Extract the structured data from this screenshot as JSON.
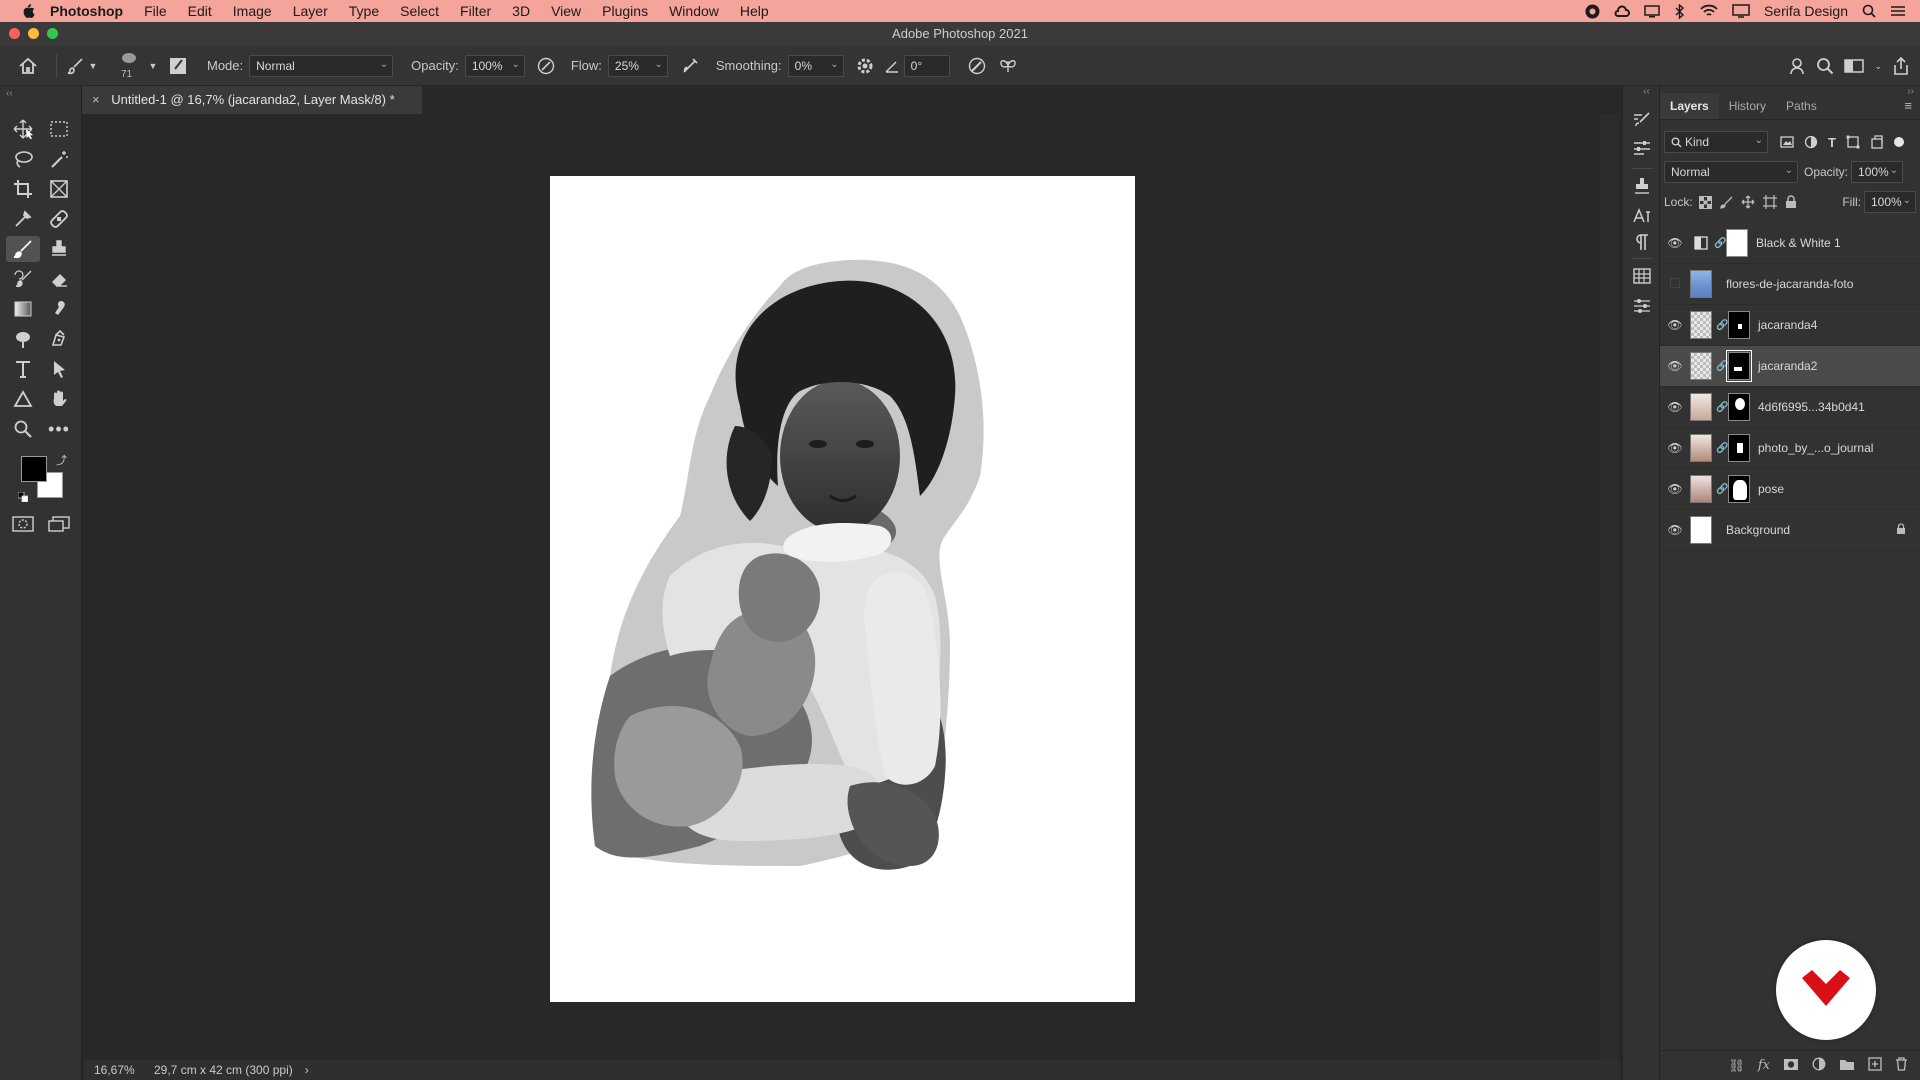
{
  "menubar": {
    "app": "Photoshop",
    "items": [
      "File",
      "Edit",
      "Image",
      "Layer",
      "Type",
      "Select",
      "Filter",
      "3D",
      "View",
      "Plugins",
      "Window",
      "Help"
    ],
    "account": "Serifa Design"
  },
  "window": {
    "title": "Adobe Photoshop 2021"
  },
  "options": {
    "brush_size": "71",
    "mode_label": "Mode:",
    "mode_value": "Normal",
    "opacity_label": "Opacity:",
    "opacity_value": "100%",
    "flow_label": "Flow:",
    "flow_value": "25%",
    "smoothing_label": "Smoothing:",
    "smoothing_value": "0%",
    "angle_value": "0°"
  },
  "document": {
    "tab_title": "Untitled-1 @ 16,7% (jacaranda2, Layer Mask/8) *",
    "close_glyph": "×"
  },
  "status": {
    "zoom": "16,67%",
    "doc_info": "29,7 cm x 42 cm (300 ppi)",
    "arrow": "›"
  },
  "layers_panel": {
    "tabs": [
      "Layers",
      "History",
      "Paths"
    ],
    "filter_value": "Kind",
    "blend_mode": "Normal",
    "opacity_label": "Opacity:",
    "opacity_value": "100%",
    "lock_label": "Lock:",
    "fill_label": "Fill:",
    "fill_value": "100%",
    "layers": [
      {
        "name": "Black & White 1",
        "visible": true,
        "kind": "adjustment"
      },
      {
        "name": "flores-de-jacaranda-foto",
        "visible": false,
        "kind": "image"
      },
      {
        "name": "jacaranda4",
        "visible": true,
        "kind": "masked"
      },
      {
        "name": "jacaranda2",
        "visible": true,
        "kind": "masked",
        "selected": true
      },
      {
        "name": "4d6f6995...34b0d41",
        "visible": true,
        "kind": "masked"
      },
      {
        "name": "photo_by_...o_journal",
        "visible": true,
        "kind": "masked"
      },
      {
        "name": "pose",
        "visible": true,
        "kind": "masked"
      },
      {
        "name": "Background",
        "visible": true,
        "kind": "background",
        "locked": true
      }
    ]
  },
  "colors": {
    "menubar": "#f4a49a",
    "brand_red": "#d90f16",
    "selected_row": "#4a4a4a"
  }
}
